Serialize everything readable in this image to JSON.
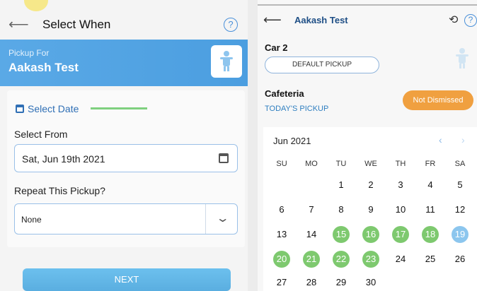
{
  "left": {
    "title": "Select When",
    "back_glyph": "⟵",
    "help_glyph": "?",
    "banner": {
      "subtitle": "Pickup For",
      "name": "Aakash Test"
    },
    "card": {
      "select_date_label": "Select Date",
      "select_from_label": "Select From",
      "date_value": "Sat, Jun 19th 2021",
      "repeat_label": "Repeat This Pickup?",
      "repeat_value": "None",
      "chevron_glyph": "⌄"
    },
    "next_label": "NEXT"
  },
  "right": {
    "back_glyph": "⟵",
    "title": "Aakash Test",
    "history_glyph": "⟲",
    "help_glyph": "?",
    "car_label": "Car 2",
    "default_pickup_label": "DEFAULT PICKUP",
    "cafeteria_label": "Cafeteria",
    "todays_pickup_label": "TODAY'S PICKUP",
    "status_label": "Not Dismissed",
    "calendar": {
      "month": "Jun 2021",
      "prev_glyph": "‹",
      "next_glyph": "›",
      "weekdays": [
        "SU",
        "MO",
        "TU",
        "WE",
        "TH",
        "FR",
        "SA"
      ],
      "weeks": [
        [
          {
            "d": ""
          },
          {
            "d": ""
          },
          {
            "d": "1"
          },
          {
            "d": "2"
          },
          {
            "d": "3"
          },
          {
            "d": "4"
          },
          {
            "d": "5"
          }
        ],
        [
          {
            "d": "6"
          },
          {
            "d": "7"
          },
          {
            "d": "8"
          },
          {
            "d": "9"
          },
          {
            "d": "10"
          },
          {
            "d": "11"
          },
          {
            "d": "12"
          }
        ],
        [
          {
            "d": "13"
          },
          {
            "d": "14"
          },
          {
            "d": "15",
            "s": "green"
          },
          {
            "d": "16",
            "s": "green"
          },
          {
            "d": "17",
            "s": "green"
          },
          {
            "d": "18",
            "s": "green"
          },
          {
            "d": "19",
            "s": "blue"
          }
        ],
        [
          {
            "d": "20",
            "s": "green"
          },
          {
            "d": "21",
            "s": "green"
          },
          {
            "d": "22",
            "s": "green"
          },
          {
            "d": "23",
            "s": "green"
          },
          {
            "d": "24"
          },
          {
            "d": "25"
          },
          {
            "d": "26"
          }
        ],
        [
          {
            "d": "27"
          },
          {
            "d": "28"
          },
          {
            "d": "29"
          },
          {
            "d": "30"
          },
          {
            "d": ""
          },
          {
            "d": ""
          },
          {
            "d": ""
          }
        ]
      ]
    }
  },
  "colors": {
    "banner_blue": "#4b9ee0",
    "title_blue": "#1f4f86",
    "status_orange": "#f0a040",
    "selected_green": "#7ec96f",
    "today_blue": "#8cc6ee"
  }
}
